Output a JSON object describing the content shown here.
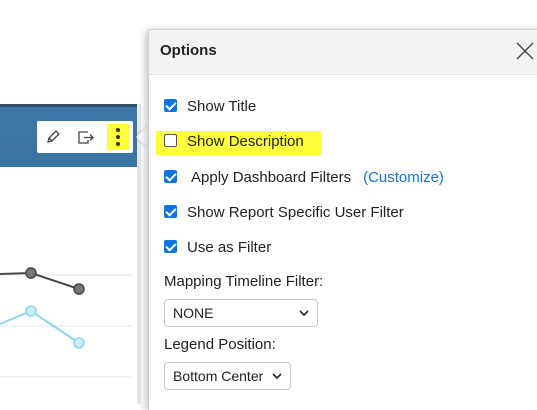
{
  "dialog": {
    "title": "Options"
  },
  "options": [
    {
      "label": "Show Title",
      "checked": true
    },
    {
      "label": "Show Description",
      "checked": false
    },
    {
      "label": "Apply Dashboard Filters",
      "checked": true,
      "link": "(Customize)"
    },
    {
      "label": "Show Report Specific User Filter",
      "checked": true
    },
    {
      "label": "Use as Filter",
      "checked": true
    }
  ],
  "mapping_timeline": {
    "label": "Mapping Timeline Filter:",
    "value": "NONE"
  },
  "legend_position": {
    "label": "Legend Position:",
    "value": "Bottom Center"
  },
  "toolbar": {
    "icons": [
      "pencil-icon",
      "export-icon",
      "more-vertical-icon"
    ]
  },
  "colors": {
    "accent": "#0b75e0",
    "link": "#1a73c7",
    "highlight": "#ffff3b",
    "card_header": "#3d78a6",
    "series_dark": "#4a4a4a",
    "series_light": "#8fd3ee"
  }
}
